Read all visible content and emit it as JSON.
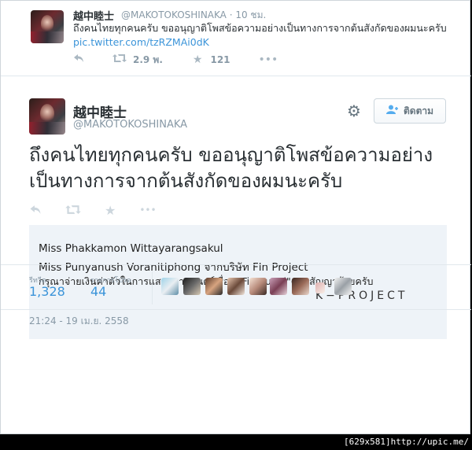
{
  "top_tweet": {
    "name": "越中睦士",
    "handle": "@MAKOTOKOSHINAKA",
    "time": "· 10 ชม.",
    "text": "ถึงคนไทยทุกคนครับ ขออนุญาติโพสข้อความอย่างเป็นทางการจากต้นสังกัดของผมนะครับ",
    "link": "pic.twitter.com/tzRZMAi0dK",
    "retweets": "2.9 พ.",
    "favorites": "121"
  },
  "tweet": {
    "name": "越中睦士",
    "handle": "@MAKOTOKOSHINAKA",
    "follow_label": "ติดตาม",
    "text": "ถึงคนไทยทุกคนครับ ขออนุญาติโพสข้อความอย่างเป็นทางการจากต้นสังกัดของผมนะครับ",
    "image_lines": [
      "Miss Phakkamon Wittayarangsakul",
      "Miss Punyanush Voranitiphong จากบริษัท Fln Project",
      "กรุณาจ่ายเงินค่าตัวในการแสดงภาพยนตร์เรื่อง \"Fin Sugoi\"ตามสัญญาด้วยครับ",
      "K−PROJECT"
    ],
    "retweets_label": "รีทวีต",
    "retweets_count": "1,328",
    "favorites_label": "รายการโปรด",
    "favorites_count": "44",
    "date": "21:24 - 19 เม.ย. 2558"
  },
  "caption": "[629x581]http://upic.me/",
  "colors": {
    "link": "#3b94d9",
    "muted": "#8899a6",
    "text": "#292f33"
  }
}
